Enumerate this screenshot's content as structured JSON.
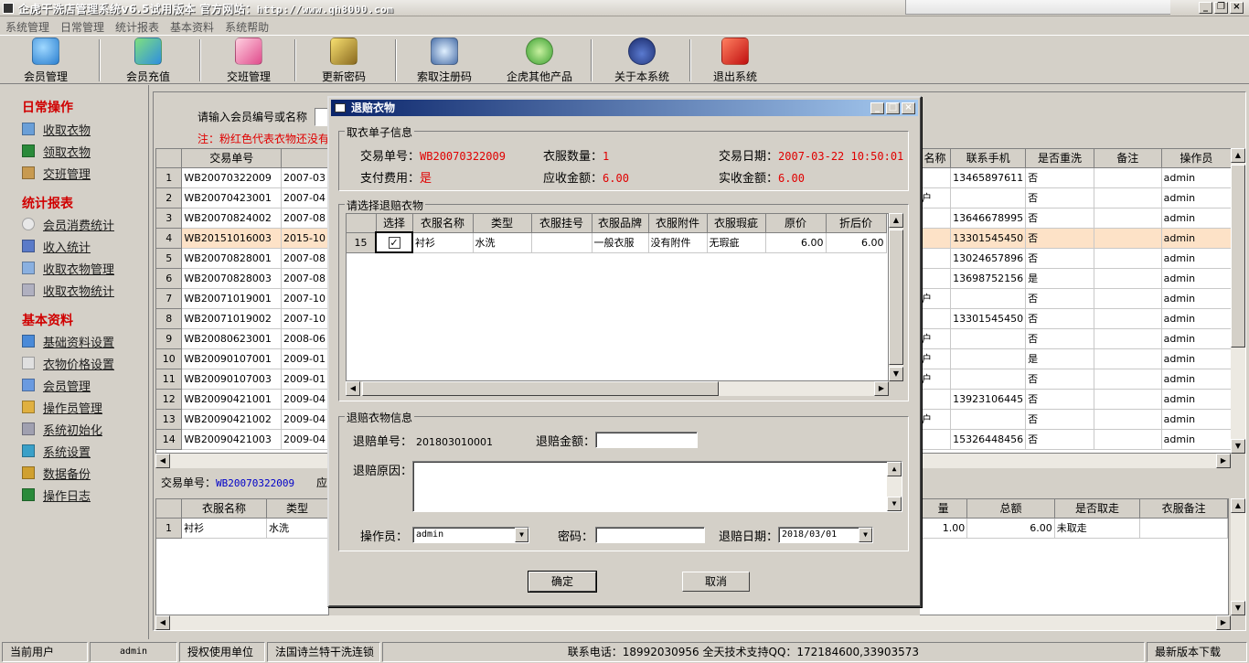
{
  "window": {
    "title": "企虎干洗店管理系统v6.5试用版本 官方网站：",
    "url": "http://www.qh8000.com"
  },
  "menu": [
    "系统管理",
    "日常管理",
    "统计报表",
    "基本资料",
    "系统帮助"
  ],
  "toolbar": [
    {
      "label": "会员管理",
      "icon": "members-icon"
    },
    {
      "label": "会员充值",
      "icon": "recharge-icon"
    },
    {
      "label": "交班管理",
      "icon": "shift-icon"
    },
    {
      "label": "更新密码",
      "icon": "key-icon"
    },
    {
      "label": "索取注册码",
      "icon": "register-icon"
    },
    {
      "label": "企虎其他产品",
      "icon": "refresh-icon"
    },
    {
      "label": "关于本系统",
      "icon": "about-icon"
    },
    {
      "label": "退出系统",
      "icon": "exit-icon"
    }
  ],
  "sidebar": {
    "sections": [
      {
        "title": "日常操作",
        "items": [
          "收取衣物",
          "领取衣物",
          "交班管理"
        ]
      },
      {
        "title": "统计报表",
        "items": [
          "会员消费统计",
          "收入统计",
          "收取衣物管理",
          "收取衣物统计"
        ]
      },
      {
        "title": "基本资料",
        "items": [
          "基础资料设置",
          "衣物价格设置",
          "会员管理",
          "操作员管理",
          "系统初始化",
          "系统设置",
          "数据备份",
          "操作日志"
        ]
      }
    ]
  },
  "search": {
    "label": "请输入会员编号或名称",
    "note": "注：粉红色代表衣物还没有"
  },
  "orders_left": {
    "headers": [
      "",
      "交易单号",
      ""
    ],
    "rows": [
      [
        "1",
        "WB20070322009",
        "2007-03"
      ],
      [
        "2",
        "WB20070423001",
        "2007-04"
      ],
      [
        "3",
        "WB20070824002",
        "2007-08"
      ],
      [
        "4",
        "WB20151016003",
        "2015-10"
      ],
      [
        "5",
        "WB20070828001",
        "2007-08"
      ],
      [
        "6",
        "WB20070828003",
        "2007-08"
      ],
      [
        "7",
        "WB20071019001",
        "2007-10"
      ],
      [
        "8",
        "WB20071019002",
        "2007-10"
      ],
      [
        "9",
        "WB20080623001",
        "2008-06"
      ],
      [
        "10",
        "WB20090107001",
        "2009-01"
      ],
      [
        "11",
        "WB20090107003",
        "2009-01"
      ],
      [
        "12",
        "WB20090421001",
        "2009-04"
      ],
      [
        "13",
        "WB20090421002",
        "2009-04"
      ],
      [
        "14",
        "WB20090421003",
        "2009-04"
      ]
    ]
  },
  "orders_right": {
    "headers": [
      "名称",
      "联系手机",
      "是否重洗",
      "备注",
      "操作员"
    ],
    "rows": [
      [
        "",
        "13465897611",
        "否",
        "",
        "admin"
      ],
      [
        "户",
        "",
        "否",
        "",
        "admin"
      ],
      [
        "",
        "13646678995",
        "否",
        "",
        "admin"
      ],
      [
        "",
        "13301545450",
        "否",
        "",
        "admin"
      ],
      [
        "",
        "13024657896",
        "否",
        "",
        "admin"
      ],
      [
        "",
        "13698752156",
        "是",
        "",
        "admin"
      ],
      [
        "户",
        "",
        "否",
        "",
        "admin"
      ],
      [
        "",
        "13301545450",
        "否",
        "",
        "admin"
      ],
      [
        "户",
        "",
        "否",
        "",
        "admin"
      ],
      [
        "户",
        "",
        "是",
        "",
        "admin"
      ],
      [
        "户",
        "",
        "否",
        "",
        "admin"
      ],
      [
        "",
        "13923106445",
        "否",
        "",
        "admin"
      ],
      [
        "户",
        "",
        "否",
        "",
        "admin"
      ],
      [
        "",
        "15326448456",
        "否",
        "",
        "admin"
      ]
    ]
  },
  "transaction": {
    "label": "交易单号：",
    "value": "WB20070322009",
    "extra": "应"
  },
  "clothes_left": {
    "headers": [
      "",
      "衣服名称",
      "类型"
    ],
    "rows": [
      [
        "1",
        "衬衫",
        "水洗"
      ]
    ]
  },
  "clothes_right": {
    "headers": [
      "量",
      "总额",
      "是否取走",
      "衣服备注"
    ],
    "rows": [
      [
        "1.00",
        "6.00",
        "未取走",
        ""
      ]
    ]
  },
  "status": {
    "current_user_label": "当前用户",
    "current_user": "admin",
    "auth_label": "授权使用单位",
    "auth_unit": "法国诗兰特干洗连锁",
    "contact": "联系电话：18992030956  全天技术支持QQ：172184600,33903573",
    "download": "最新版本下载"
  },
  "dialog": {
    "title": "退赔衣物",
    "order_group": "取衣单子信息",
    "order_no_label": "交易单号：",
    "order_no": "WB20070322009",
    "qty_label": "衣服数量：",
    "qty": "1",
    "date_label": "交易日期：",
    "date": "2007-03-22 10:50:01",
    "paid_label": "支付费用：",
    "paid": "是",
    "due_label": "应收金额：",
    "due": "6.00",
    "received_label": "实收金额：",
    "received": "6.00",
    "select_group": "请选择退赔衣物",
    "clothes_headers": [
      "",
      "选择",
      "衣服名称",
      "类型",
      "衣服挂号",
      "衣服品牌",
      "衣服附件",
      "衣服瑕疵",
      "原价",
      "折后价"
    ],
    "clothes_rows": [
      {
        "no": "15",
        "checked": "✓",
        "name": "衬衫",
        "type": "水洗",
        "tag": "",
        "brand": "一般衣服",
        "attach": "没有附件",
        "flaw": "无瑕疵",
        "price": "6.00",
        "discount": "6.00"
      }
    ],
    "refund_group": "退赔衣物信息",
    "refund_no_label": "退赔单号：",
    "refund_no": "201803010001",
    "refund_amount_label": "退赔金额：",
    "refund_amount": "",
    "reason_label": "退赔原因：",
    "operator_label": "操作员：",
    "operator": "admin",
    "password_label": "密码：",
    "password": "",
    "refund_date_label": "退赔日期：",
    "refund_date": "2018/03/01",
    "ok": "确定",
    "cancel": "取消"
  }
}
